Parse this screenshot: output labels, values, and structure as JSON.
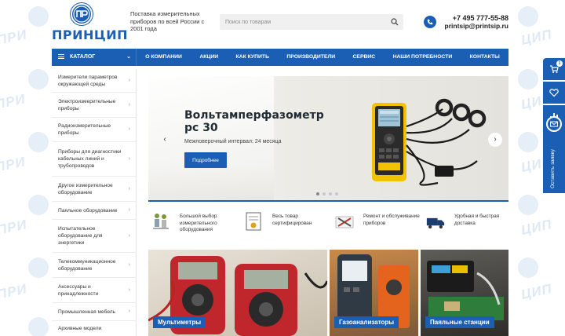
{
  "brand": {
    "logo_text": "ПРИНЦИП",
    "logo_letters": "ПР",
    "tagline": "Поставка измерительных приборов по всей России с 2001 года",
    "watermark_text": "ПРИ",
    "watermark_text_alt": "ЦИП"
  },
  "search": {
    "placeholder": "Поиск по товарам",
    "icon": "search-icon"
  },
  "contacts": {
    "phone": "+7 495 777-55-88",
    "email": "printsip@printsip.ru",
    "icon": "phone-icon"
  },
  "nav": {
    "catalog_label": "КАТАЛОГ",
    "links": [
      "О КОМПАНИИ",
      "АКЦИИ",
      "КАК КУПИТЬ",
      "ПРОИЗВОДИТЕЛИ",
      "СЕРВИС",
      "НАШИ ПОТРЕБНОСТИ",
      "КОНТАКТЫ"
    ]
  },
  "sidebar": {
    "items": [
      "Измерители параметров окружающей среды",
      "Электроизмерительные приборы",
      "Радиоизмерительные приборы",
      "Приборы для диагностики кабельных линий и трубопроводов",
      "Другое измерительное оборудование",
      "Паяльное оборудование",
      "Испытательное оборудование для энергетики",
      "Телекоммуникационное оборудование",
      "Аксессуары и принадлежности",
      "Промышленная мебель",
      "Архивные модели"
    ]
  },
  "slider": {
    "title": "Вольтамперфазометр рс 30",
    "subtitle": "Межповерочный интервал: 24 месяца",
    "button_label": "Подробнее",
    "prev": "‹",
    "next": "›",
    "active_dot": 0,
    "dots_count": 4
  },
  "features": [
    {
      "text": "Большой выбор измерительного оборудования",
      "icon": "workers-icon"
    },
    {
      "text": "Весь товар сертифицирован",
      "icon": "certificate-icon"
    },
    {
      "text": "Ремонт и обслуживание приборов",
      "icon": "tools-icon"
    },
    {
      "text": "Удобная и быстрая доставка",
      "icon": "truck-icon"
    }
  ],
  "categories": [
    "Мультиметры",
    "Газоанализаторы",
    "Паяльные станции"
  ],
  "right_panel": {
    "cart_count": "1",
    "feedback_label": "Оставить заявку",
    "icons": [
      "cart-icon",
      "compare-icon",
      "mail-icon"
    ]
  },
  "colors": {
    "brand_blue": "#1a5fb4"
  }
}
